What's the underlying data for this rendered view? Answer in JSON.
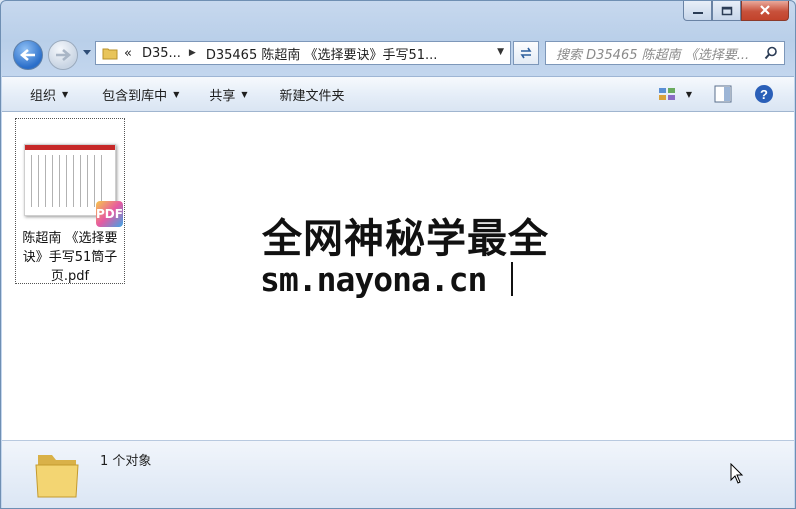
{
  "window": {
    "caption": {
      "minimize": "▬",
      "maximize": "□",
      "close": "✕"
    }
  },
  "nav": {
    "address_chevron": "«",
    "address_seg1": "D35...",
    "address_seg2": "D35465 陈超南 《选择要诀》手写51...",
    "search_placeholder": "搜索 D35465 陈超南 《选择要..."
  },
  "toolbar": {
    "organize": "组织",
    "include_library": "包含到库中",
    "share": "共享",
    "new_folder": "新建文件夹"
  },
  "content": {
    "file_name": "陈超南 《选择要诀》手写51筒子页.pdf",
    "file_badge": "PDF",
    "thumb_header": "PDF",
    "watermark_line1": "全网神秘学最全",
    "watermark_line2": "sm.nayona.cn"
  },
  "status": {
    "count_text": "1 个对象"
  },
  "colors": {
    "accent": "#2a6ec9",
    "close": "#c8513b",
    "pdf_bar": "#c62828"
  }
}
